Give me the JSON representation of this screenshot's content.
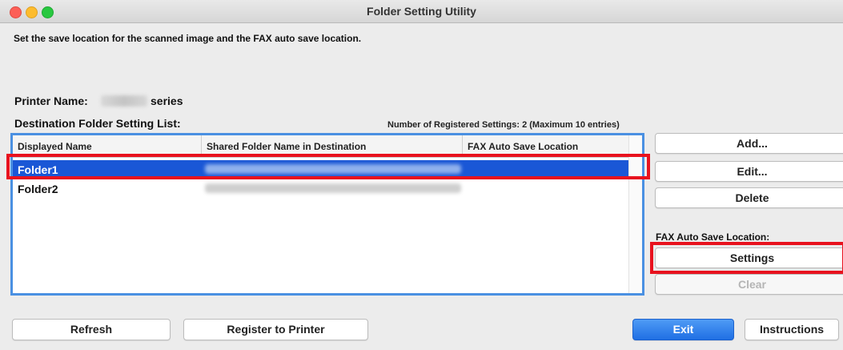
{
  "window": {
    "title": "Folder Setting Utility"
  },
  "description": "Set the save location for the scanned image and the FAX auto save location.",
  "printer": {
    "label": "Printer Name:",
    "suffix": "series"
  },
  "list": {
    "label": "Destination Folder Setting List:",
    "count_text": "Number of Registered Settings: 2 (Maximum 10 entries)",
    "columns": [
      "Displayed Name",
      "Shared Folder Name in Destination",
      "FAX Auto Save Location"
    ],
    "rows": [
      {
        "name": "Folder1",
        "selected": true
      },
      {
        "name": "Folder2",
        "selected": false
      }
    ]
  },
  "side_buttons": {
    "add": "Add...",
    "edit": "Edit...",
    "delete": "Delete"
  },
  "fax": {
    "label": "FAX Auto Save Location:",
    "settings": "Settings",
    "clear": "Clear"
  },
  "bottom_buttons": {
    "refresh": "Refresh",
    "register": "Register to Printer",
    "exit": "Exit",
    "instructions": "Instructions"
  },
  "colors": {
    "accent": "#1a57d6",
    "list_border": "#4a90e2",
    "highlight": "#e8121e",
    "exit_button": "#1f6fe4"
  }
}
